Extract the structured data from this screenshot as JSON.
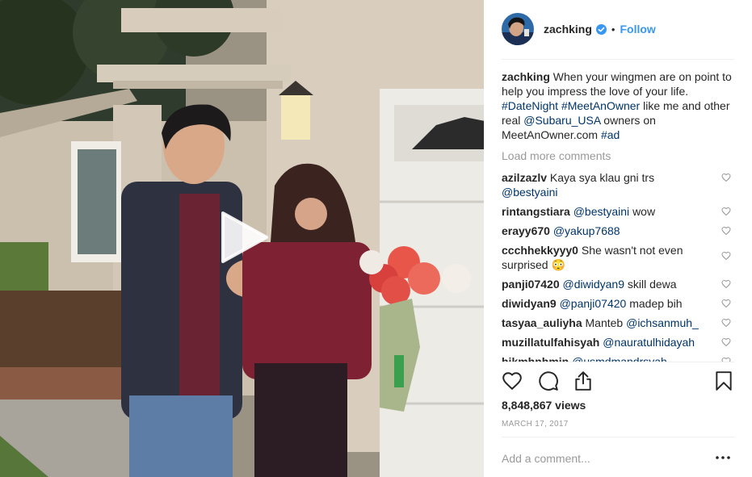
{
  "post": {
    "username": "zachking",
    "dot": "•",
    "follow_label": "Follow",
    "caption": {
      "username": "zachking",
      "text_1": "When your wingmen are on point to help you impress the love of your life.",
      "tag_1": "#DateNight",
      "tag_2": "#MeetAnOwner",
      "text_2": "like me and other real",
      "tag_3": "@Subaru_USA",
      "text_3": "owners on MeetAnOwner.com",
      "tag_4": "#ad"
    },
    "load_more_label": "Load more comments",
    "comments": [
      {
        "user": "azilzazlv",
        "text": "Kaya sya klau gni trs",
        "mention": "@bestyaini",
        "mention_first": false,
        "mention_newline": true
      },
      {
        "user": "rintangstiara",
        "mention": "@bestyaini",
        "text": "wow",
        "mention_first": true
      },
      {
        "user": "erayy670",
        "mention": "@yakup7688",
        "text": "",
        "mention_first": true
      },
      {
        "user": "ccchhekkyyy0",
        "text": "She wasn't not even surprised",
        "emoji": "😳",
        "mention_first": false
      },
      {
        "user": "panji07420",
        "mention": "@diwidyan9",
        "text": "skill dewa",
        "mention_first": true
      },
      {
        "user": "diwidyan9",
        "mention": "@panji07420",
        "text": "madep bih",
        "mention_first": true
      },
      {
        "user": "tasyaa_auliyha",
        "text": "Manteb",
        "mention": "@ichsanmuh_",
        "mention_first": false
      },
      {
        "user": "muzillatulfahisyah",
        "mention": "@nauratulhidayah",
        "text": "",
        "mention_first": true
      },
      {
        "user": "hikmhnhmin",
        "mention": "@usmdmandrsyah",
        "text": "",
        "mention_first": true
      }
    ],
    "views": "8,848,867 views",
    "date": "MARCH 17, 2017",
    "add_comment_placeholder": "Add a comment...",
    "more_label": "•••"
  },
  "icons": {
    "play": "play-icon",
    "verified": "verified-badge-icon",
    "like": "heart-icon",
    "comment": "comment-bubble-icon",
    "share": "share-icon",
    "save": "bookmark-icon",
    "more": "more-options-icon"
  },
  "colors": {
    "link_blue": "#3897f0",
    "tag_blue": "#003569",
    "muted_gray": "#999999",
    "text_dark": "#262626"
  }
}
